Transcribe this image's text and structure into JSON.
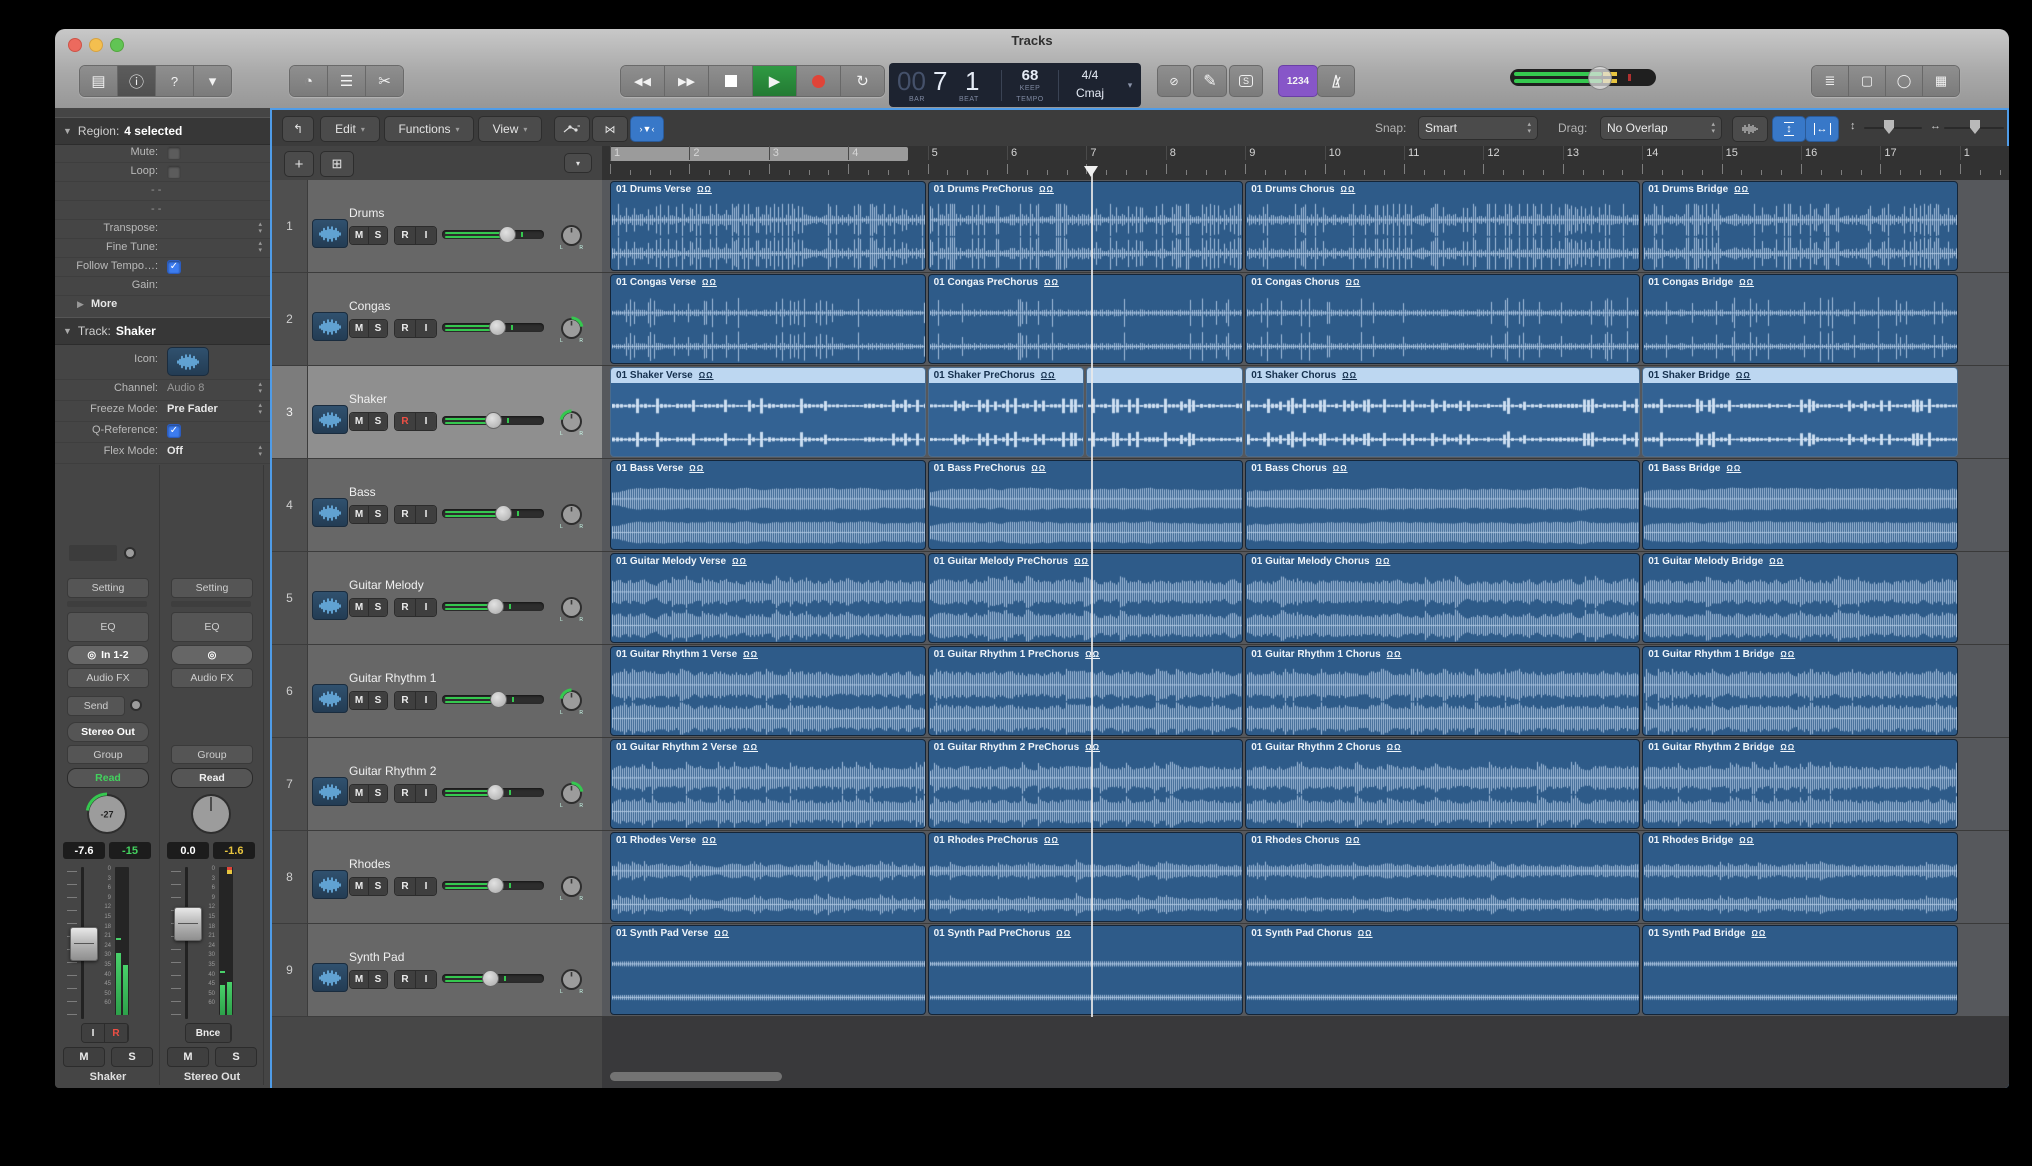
{
  "window": {
    "title": "Tracks"
  },
  "toolbar": {
    "left_icons": [
      "library-icon",
      "inspector-icon",
      "quick-help-icon",
      "toolbar-icon"
    ],
    "mid_icons": [
      "smart-controls-icon",
      "mixer-icon",
      "editors-icon"
    ],
    "count_in": "1234",
    "right_icons": [
      "list-editors-icon",
      "note-pads-icon",
      "loop-browser-icon",
      "media-browser-icon"
    ]
  },
  "lcd": {
    "bar_prefix": "00",
    "bar": "7",
    "beat": "1",
    "bar_label": "BAR",
    "beat_label": "BEAT",
    "tempo": "68",
    "tempo_mode": "KEEP",
    "tempo_label": "TEMPO",
    "time_sig": "4/4",
    "key": "Cmaj"
  },
  "area_toolbar": {
    "edit": "Edit",
    "functions": "Functions",
    "view": "View",
    "snap_label": "Snap:",
    "snap_value": "Smart",
    "drag_label": "Drag:",
    "drag_value": "No Overlap"
  },
  "inspector": {
    "region_header": {
      "label": "Region:",
      "value": "4 selected"
    },
    "region_rows": [
      {
        "label": "Mute:",
        "control": "checkbox",
        "checked": false
      },
      {
        "label": "Loop:",
        "control": "checkbox",
        "checked": false
      },
      {
        "label": "- -",
        "control": "dashes"
      },
      {
        "label": "- -",
        "control": "dashes"
      },
      {
        "label": "Transpose:",
        "control": "stepper"
      },
      {
        "label": "Fine Tune:",
        "control": "stepper"
      },
      {
        "label": "Follow Tempo…:",
        "control": "checkbox",
        "checked": true
      },
      {
        "label": "Gain:",
        "control": "none"
      }
    ],
    "more_label": "More",
    "track_header": {
      "label": "Track:",
      "value": "Shaker"
    },
    "track_rows": [
      {
        "label": "Icon:",
        "control": "icon"
      },
      {
        "label": "Channel:",
        "value": "Audio 8",
        "dim": true,
        "control": "stepper"
      },
      {
        "label": "Freeze Mode:",
        "value": "Pre Fader",
        "dim": false,
        "control": "stepper"
      },
      {
        "label": "Q-Reference:",
        "control": "checkbox",
        "checked": true
      },
      {
        "label": "Flex Mode:",
        "value": "Off",
        "dim": false,
        "control": "stepper"
      }
    ]
  },
  "strips": [
    {
      "name": "Shaker",
      "setting": "Setting",
      "eq": "EQ",
      "input": "In 1-2",
      "audio_fx": "Audio FX",
      "send": "Send",
      "output": "Stereo Out",
      "group": "Group",
      "automation": "Read",
      "automation_color": "#43d15e",
      "pan": "-27",
      "pan_arc": "left",
      "vol": "-7.6",
      "peak": "-15",
      "peak_color": "#43d15e",
      "rec_btns": [
        "I",
        "R"
      ],
      "mute": "M",
      "solo": "S",
      "fader_pos": 0.5,
      "meter": [
        0.42,
        0.34
      ],
      "clip": false
    },
    {
      "name": "Stereo Out",
      "setting": "Setting",
      "eq": "EQ",
      "input": "",
      "audio_fx": "Audio FX",
      "group": "Group",
      "automation": "Read",
      "automation_color": "#f0f0f0",
      "pan": "",
      "pan_arc": "none",
      "vol": "0.0",
      "peak": "-1.6",
      "peak_color": "#e8c53f",
      "rec_btns": [
        "Bnce"
      ],
      "mute": "M",
      "solo": "S",
      "fader_pos": 0.33,
      "meter": [
        0.2,
        0.22
      ],
      "clip": true
    }
  ],
  "meter_scale": [
    "0",
    "3",
    "6",
    "9",
    "12",
    "15",
    "18",
    "21",
    "24",
    "30",
    "35",
    "40",
    "45",
    "50",
    "60"
  ],
  "ruler": {
    "bars": [
      "1",
      "2",
      "3",
      "4",
      "5",
      "6",
      "7",
      "8",
      "9",
      "10",
      "11",
      "12",
      "13",
      "14",
      "15",
      "16",
      "17",
      "1"
    ],
    "cycle_start": 1,
    "cycle_end": 4.75
  },
  "playhead_bar": 7.07,
  "sections": [
    "Verse",
    "PreChorus",
    "Chorus",
    "Bridge"
  ],
  "tracks": [
    {
      "num": "1",
      "name": "Drums",
      "wave": "drums",
      "vol_pct": 0.68,
      "pan_arc": "none",
      "rec": false,
      "selected": false,
      "regions": [
        {
          "name": "01 Drums Verse",
          "s": 1,
          "e": 5
        },
        {
          "name": "01 Drums PreChorus",
          "s": 5,
          "e": 9
        },
        {
          "name": "01 Drums Chorus",
          "s": 9,
          "e": 14
        },
        {
          "name": "01 Drums Bridge",
          "s": 14,
          "e": 18
        }
      ]
    },
    {
      "num": "2",
      "name": "Congas",
      "wave": "congas",
      "vol_pct": 0.57,
      "pan_arc": "right",
      "rec": false,
      "selected": false,
      "regions": [
        {
          "name": "01 Congas Verse",
          "s": 1,
          "e": 5
        },
        {
          "name": "01 Congas PreChorus",
          "s": 5,
          "e": 9
        },
        {
          "name": "01 Congas Chorus",
          "s": 9,
          "e": 14
        },
        {
          "name": "01 Congas Bridge",
          "s": 14,
          "e": 18
        }
      ]
    },
    {
      "num": "3",
      "name": "Shaker",
      "wave": "shaker",
      "vol_pct": 0.53,
      "pan_arc": "left",
      "rec": true,
      "selected": true,
      "regions": [
        {
          "name": "01 Shaker Verse",
          "s": 1,
          "e": 5,
          "sel": true
        },
        {
          "name": "01 Shaker PreChorus",
          "s": 5,
          "e": 7,
          "sel": true
        },
        {
          "name": "",
          "s": 7,
          "e": 9,
          "sel": true
        },
        {
          "name": "01 Shaker Chorus",
          "s": 9,
          "e": 14,
          "sel": true
        },
        {
          "name": "01 Shaker Bridge",
          "s": 14,
          "e": 18,
          "sel": true
        }
      ]
    },
    {
      "num": "4",
      "name": "Bass",
      "wave": "bass",
      "vol_pct": 0.64,
      "pan_arc": "none",
      "rec": false,
      "selected": false,
      "regions": [
        {
          "name": "01 Bass Verse",
          "s": 1,
          "e": 5
        },
        {
          "name": "01 Bass PreChorus",
          "s": 5,
          "e": 9
        },
        {
          "name": "01 Bass Chorus",
          "s": 9,
          "e": 14
        },
        {
          "name": "01 Bass Bridge",
          "s": 14,
          "e": 18
        }
      ]
    },
    {
      "num": "5",
      "name": "Guitar Melody",
      "wave": "gmel",
      "vol_pct": 0.55,
      "pan_arc": "none",
      "rec": false,
      "selected": false,
      "regions": [
        {
          "name": "01 Guitar Melody Verse",
          "s": 1,
          "e": 5
        },
        {
          "name": "01 Guitar Melody PreChorus",
          "s": 5,
          "e": 9
        },
        {
          "name": "01 Guitar Melody Chorus",
          "s": 9,
          "e": 14
        },
        {
          "name": "01 Guitar Melody Bridge",
          "s": 14,
          "e": 18
        }
      ]
    },
    {
      "num": "6",
      "name": "Guitar Rhythm 1",
      "wave": "gr1",
      "vol_pct": 0.58,
      "pan_arc": "left",
      "rec": false,
      "selected": false,
      "regions": [
        {
          "name": "01 Guitar Rhythm 1 Verse",
          "s": 1,
          "e": 5
        },
        {
          "name": "01 Guitar Rhythm 1 PreChorus",
          "s": 5,
          "e": 9
        },
        {
          "name": "01 Guitar Rhythm 1 Chorus",
          "s": 9,
          "e": 14
        },
        {
          "name": "01 Guitar Rhythm 1 Bridge",
          "s": 14,
          "e": 18
        }
      ]
    },
    {
      "num": "7",
      "name": "Guitar Rhythm 2",
      "wave": "gr2",
      "vol_pct": 0.55,
      "pan_arc": "right",
      "rec": false,
      "selected": false,
      "regions": [
        {
          "name": "01 Guitar Rhythm 2 Verse",
          "s": 1,
          "e": 5
        },
        {
          "name": "01 Guitar Rhythm 2 PreChorus",
          "s": 5,
          "e": 9
        },
        {
          "name": "01 Guitar Rhythm 2 Chorus",
          "s": 9,
          "e": 14
        },
        {
          "name": "01 Guitar Rhythm 2 Bridge",
          "s": 14,
          "e": 18
        }
      ]
    },
    {
      "num": "8",
      "name": "Rhodes",
      "wave": "rhodes",
      "vol_pct": 0.55,
      "pan_arc": "none",
      "rec": false,
      "selected": false,
      "regions": [
        {
          "name": "01 Rhodes Verse",
          "s": 1,
          "e": 5
        },
        {
          "name": "01 Rhodes PreChorus",
          "s": 5,
          "e": 9
        },
        {
          "name": "01 Rhodes Chorus",
          "s": 9,
          "e": 14
        },
        {
          "name": "01 Rhodes Bridge",
          "s": 14,
          "e": 18
        }
      ]
    },
    {
      "num": "9",
      "name": "Synth Pad",
      "wave": "pad",
      "vol_pct": 0.5,
      "pan_arc": "none",
      "rec": false,
      "selected": false,
      "regions": [
        {
          "name": "01 Synth Pad Verse",
          "s": 1,
          "e": 5
        },
        {
          "name": "01 Synth Pad PreChorus",
          "s": 5,
          "e": 9
        },
        {
          "name": "01 Synth Pad Chorus",
          "s": 9,
          "e": 14
        },
        {
          "name": "01 Synth Pad Bridge",
          "s": 14,
          "e": 18
        }
      ]
    }
  ],
  "colors": {
    "accent_blue": "#4f9ce8",
    "region_blue": "#2e5b89",
    "selected_header": "#bdd7f1",
    "green": "#35c84f",
    "record_red": "#e04438",
    "play_green": "#2f9a43",
    "count_in_purple": "#8756c8"
  }
}
